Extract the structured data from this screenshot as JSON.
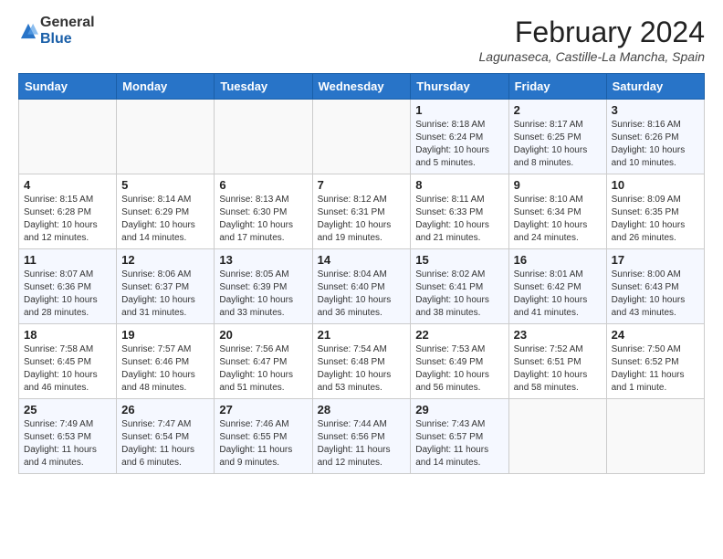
{
  "header": {
    "logo_general": "General",
    "logo_blue": "Blue",
    "title": "February 2024",
    "subtitle": "Lagunaseca, Castille-La Mancha, Spain"
  },
  "days_of_week": [
    "Sunday",
    "Monday",
    "Tuesday",
    "Wednesday",
    "Thursday",
    "Friday",
    "Saturday"
  ],
  "weeks": [
    [
      {
        "day": "",
        "text": ""
      },
      {
        "day": "",
        "text": ""
      },
      {
        "day": "",
        "text": ""
      },
      {
        "day": "",
        "text": ""
      },
      {
        "day": "1",
        "text": "Sunrise: 8:18 AM\nSunset: 6:24 PM\nDaylight: 10 hours and 5 minutes."
      },
      {
        "day": "2",
        "text": "Sunrise: 8:17 AM\nSunset: 6:25 PM\nDaylight: 10 hours and 8 minutes."
      },
      {
        "day": "3",
        "text": "Sunrise: 8:16 AM\nSunset: 6:26 PM\nDaylight: 10 hours and 10 minutes."
      }
    ],
    [
      {
        "day": "4",
        "text": "Sunrise: 8:15 AM\nSunset: 6:28 PM\nDaylight: 10 hours and 12 minutes."
      },
      {
        "day": "5",
        "text": "Sunrise: 8:14 AM\nSunset: 6:29 PM\nDaylight: 10 hours and 14 minutes."
      },
      {
        "day": "6",
        "text": "Sunrise: 8:13 AM\nSunset: 6:30 PM\nDaylight: 10 hours and 17 minutes."
      },
      {
        "day": "7",
        "text": "Sunrise: 8:12 AM\nSunset: 6:31 PM\nDaylight: 10 hours and 19 minutes."
      },
      {
        "day": "8",
        "text": "Sunrise: 8:11 AM\nSunset: 6:33 PM\nDaylight: 10 hours and 21 minutes."
      },
      {
        "day": "9",
        "text": "Sunrise: 8:10 AM\nSunset: 6:34 PM\nDaylight: 10 hours and 24 minutes."
      },
      {
        "day": "10",
        "text": "Sunrise: 8:09 AM\nSunset: 6:35 PM\nDaylight: 10 hours and 26 minutes."
      }
    ],
    [
      {
        "day": "11",
        "text": "Sunrise: 8:07 AM\nSunset: 6:36 PM\nDaylight: 10 hours and 28 minutes."
      },
      {
        "day": "12",
        "text": "Sunrise: 8:06 AM\nSunset: 6:37 PM\nDaylight: 10 hours and 31 minutes."
      },
      {
        "day": "13",
        "text": "Sunrise: 8:05 AM\nSunset: 6:39 PM\nDaylight: 10 hours and 33 minutes."
      },
      {
        "day": "14",
        "text": "Sunrise: 8:04 AM\nSunset: 6:40 PM\nDaylight: 10 hours and 36 minutes."
      },
      {
        "day": "15",
        "text": "Sunrise: 8:02 AM\nSunset: 6:41 PM\nDaylight: 10 hours and 38 minutes."
      },
      {
        "day": "16",
        "text": "Sunrise: 8:01 AM\nSunset: 6:42 PM\nDaylight: 10 hours and 41 minutes."
      },
      {
        "day": "17",
        "text": "Sunrise: 8:00 AM\nSunset: 6:43 PM\nDaylight: 10 hours and 43 minutes."
      }
    ],
    [
      {
        "day": "18",
        "text": "Sunrise: 7:58 AM\nSunset: 6:45 PM\nDaylight: 10 hours and 46 minutes."
      },
      {
        "day": "19",
        "text": "Sunrise: 7:57 AM\nSunset: 6:46 PM\nDaylight: 10 hours and 48 minutes."
      },
      {
        "day": "20",
        "text": "Sunrise: 7:56 AM\nSunset: 6:47 PM\nDaylight: 10 hours and 51 minutes."
      },
      {
        "day": "21",
        "text": "Sunrise: 7:54 AM\nSunset: 6:48 PM\nDaylight: 10 hours and 53 minutes."
      },
      {
        "day": "22",
        "text": "Sunrise: 7:53 AM\nSunset: 6:49 PM\nDaylight: 10 hours and 56 minutes."
      },
      {
        "day": "23",
        "text": "Sunrise: 7:52 AM\nSunset: 6:51 PM\nDaylight: 10 hours and 58 minutes."
      },
      {
        "day": "24",
        "text": "Sunrise: 7:50 AM\nSunset: 6:52 PM\nDaylight: 11 hours and 1 minute."
      }
    ],
    [
      {
        "day": "25",
        "text": "Sunrise: 7:49 AM\nSunset: 6:53 PM\nDaylight: 11 hours and 4 minutes."
      },
      {
        "day": "26",
        "text": "Sunrise: 7:47 AM\nSunset: 6:54 PM\nDaylight: 11 hours and 6 minutes."
      },
      {
        "day": "27",
        "text": "Sunrise: 7:46 AM\nSunset: 6:55 PM\nDaylight: 11 hours and 9 minutes."
      },
      {
        "day": "28",
        "text": "Sunrise: 7:44 AM\nSunset: 6:56 PM\nDaylight: 11 hours and 12 minutes."
      },
      {
        "day": "29",
        "text": "Sunrise: 7:43 AM\nSunset: 6:57 PM\nDaylight: 11 hours and 14 minutes."
      },
      {
        "day": "",
        "text": ""
      },
      {
        "day": "",
        "text": ""
      }
    ]
  ]
}
